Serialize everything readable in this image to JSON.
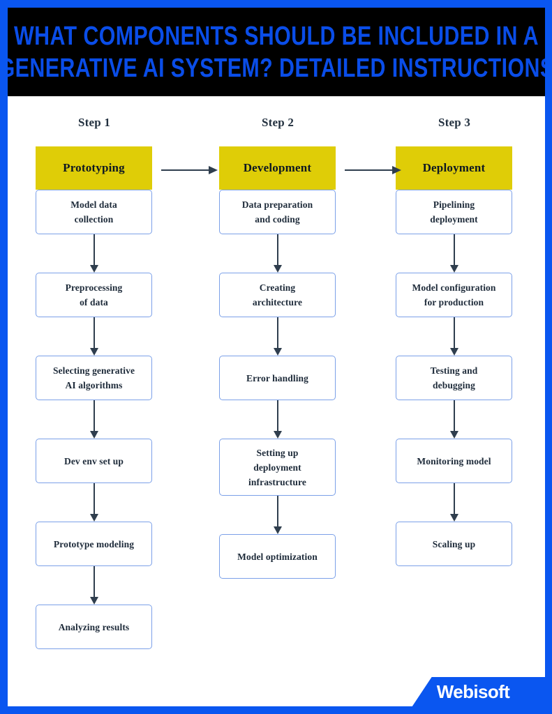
{
  "poster": {
    "frame_color": "#0A56F0",
    "header_bg": "#000000",
    "title_color": "#0A4DE8",
    "phase_box_color": "#DFCD07",
    "node_border_color": "#7BA0E8",
    "arrow_color": "#2F3E4E",
    "text_color": "#1E2B3A"
  },
  "header": {
    "title_line_1": "WHAT COMPONENTS SHOULD BE INCLUDED IN A",
    "title_line_2": "GENERATIVE AI SYSTEM? DETAILED INSTRUCTIONS"
  },
  "columns": [
    {
      "step_label": "Step 1",
      "phase": "Prototyping",
      "nodes": [
        "Model data\ncollection",
        "Preprocessing\nof data",
        "Selecting generative\nAI algorithms",
        "Dev env set up",
        "Prototype modeling",
        "Analyzing results"
      ]
    },
    {
      "step_label": "Step 2",
      "phase": "Development",
      "nodes": [
        "Data preparation\nand coding",
        "Creating\narchitecture",
        "Error handling",
        "Setting up\ndeployment\ninfrastructure",
        "Model optimization"
      ]
    },
    {
      "step_label": "Step 3",
      "phase": "Deployment",
      "nodes": [
        "Pipelining\ndeployment",
        "Model configuration\nfor production",
        "Testing and\ndebugging",
        "Monitoring model",
        "Scaling up"
      ]
    }
  ],
  "footer": {
    "logo_text": "Webisoft"
  }
}
